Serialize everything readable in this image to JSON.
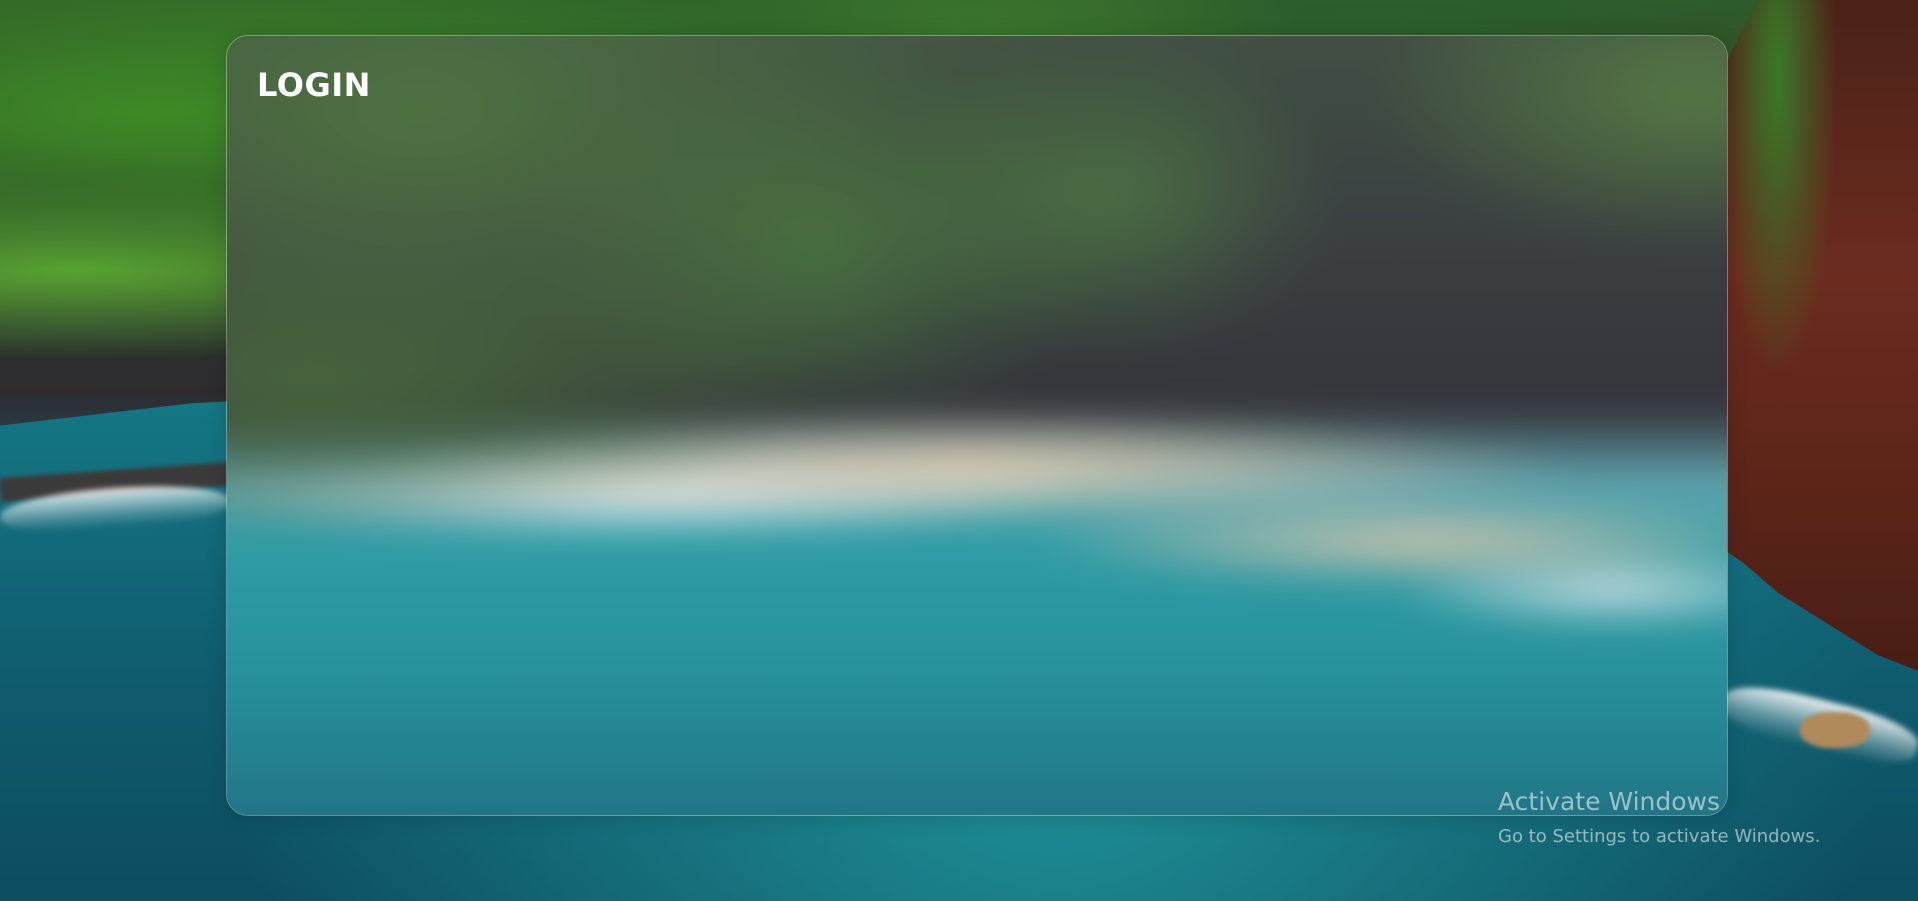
{
  "login_panel": {
    "title": "LOGIN"
  },
  "watermark": {
    "title": "Activate Windows",
    "subtitle": "Go to Settings to activate Windows."
  },
  "colors": {
    "panel_border": "#ffffff",
    "title_text": "#ffffff",
    "ocean": "#1a7f8c",
    "land_green": "#3e8a26",
    "cliff_red": "#6b2c1e"
  }
}
